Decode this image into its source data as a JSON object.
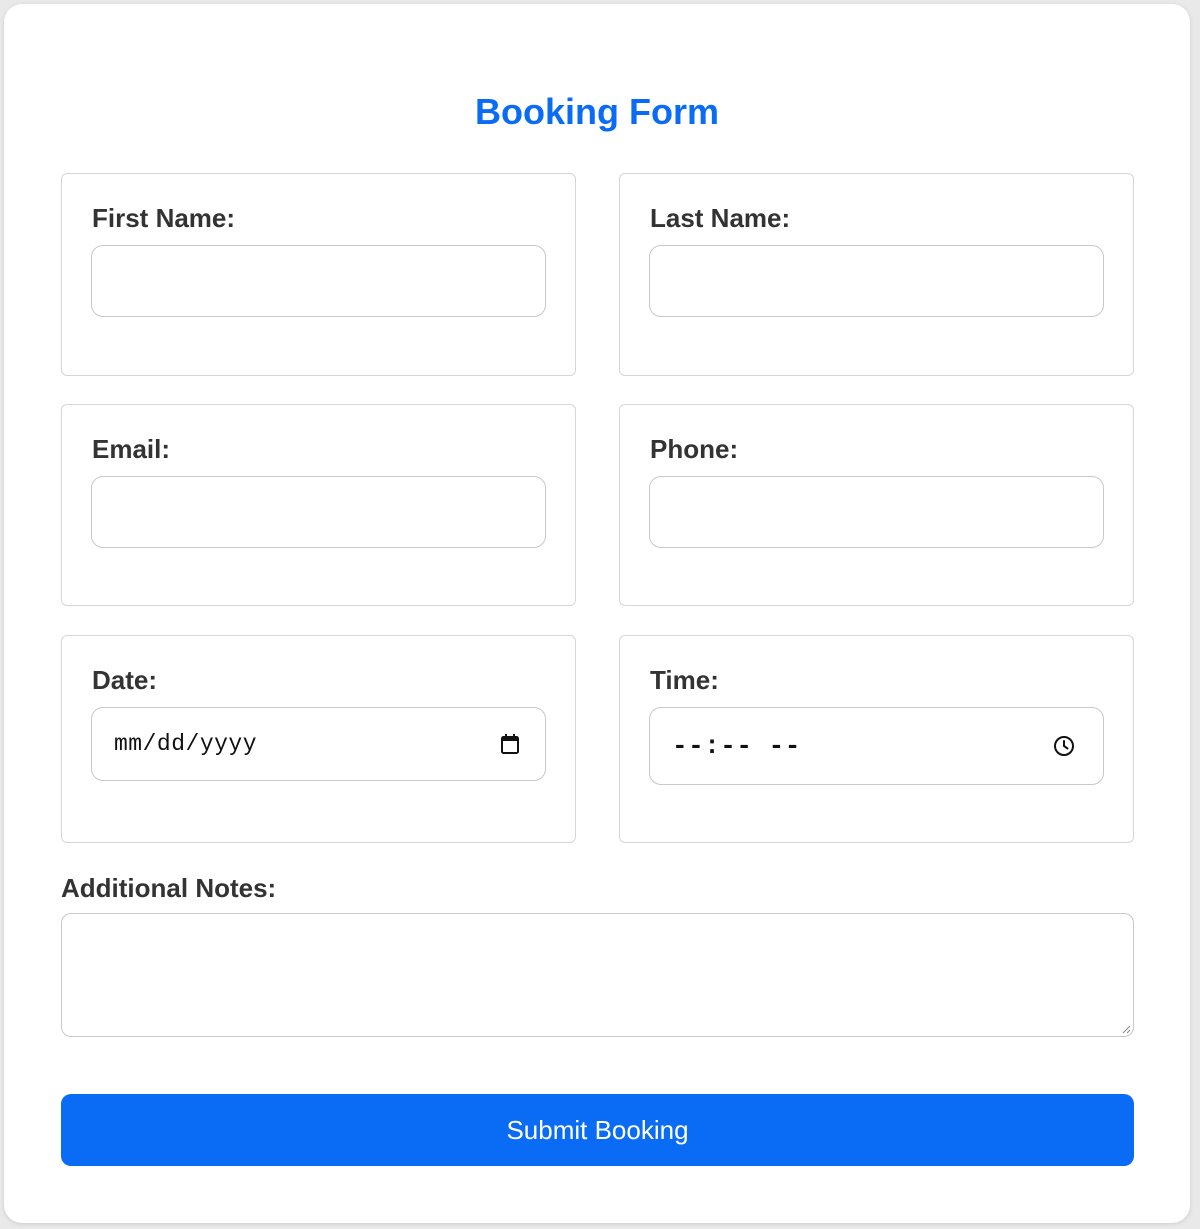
{
  "form": {
    "title": "Booking Form",
    "fields": {
      "first_name": {
        "label": "First Name:",
        "value": ""
      },
      "last_name": {
        "label": "Last Name:",
        "value": ""
      },
      "email": {
        "label": "Email:",
        "value": ""
      },
      "phone": {
        "label": "Phone:",
        "value": ""
      },
      "date": {
        "label": "Date:",
        "placeholder": "mm/dd/yyyy",
        "icon": "calendar-icon"
      },
      "time": {
        "label": "Time:",
        "placeholder": "--:-- --",
        "icon": "clock-icon"
      },
      "notes": {
        "label": "Additional Notes:",
        "value": ""
      }
    },
    "submit_label": "Submit Booking"
  },
  "colors": {
    "accent": "#0a6cf5",
    "label_text": "#333333",
    "border": "#d6d6d6",
    "page_background": "#e9e9e9"
  }
}
